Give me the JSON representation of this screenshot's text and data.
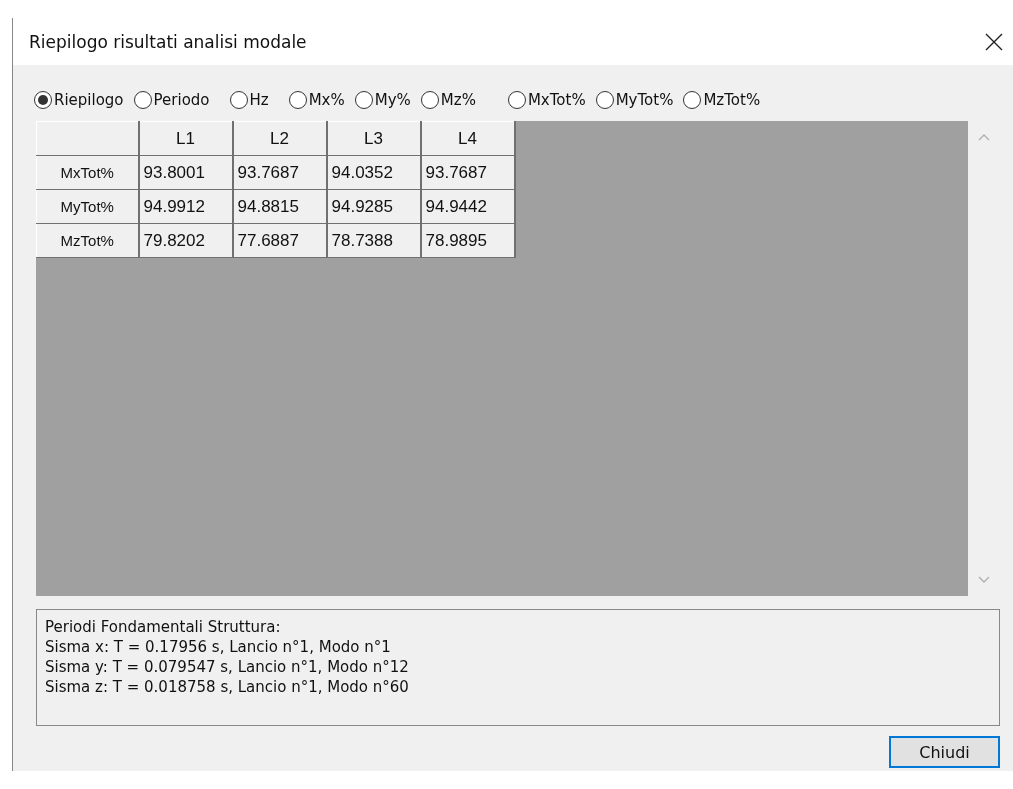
{
  "window": {
    "title": "Riepilogo risultati analisi modale"
  },
  "options": [
    {
      "label": "Riepilogo",
      "selected": true
    },
    {
      "label": "Periodo",
      "selected": false
    },
    {
      "label": "Hz",
      "selected": false
    },
    {
      "label": "Mx%",
      "selected": false
    },
    {
      "label": "My%",
      "selected": false
    },
    {
      "label": "Mz%",
      "selected": false
    },
    {
      "label": "MxTot%",
      "selected": false
    },
    {
      "label": "MyTot%",
      "selected": false
    },
    {
      "label": "MzTot%",
      "selected": false
    }
  ],
  "table": {
    "columns": [
      "L1",
      "L2",
      "L3",
      "L4"
    ],
    "rows": [
      {
        "header": "MxTot%",
        "cells": [
          "93.8001",
          "93.7687",
          "94.0352",
          "93.7687"
        ]
      },
      {
        "header": "MyTot%",
        "cells": [
          "94.9912",
          "94.8815",
          "94.9285",
          "94.9442"
        ]
      },
      {
        "header": "MzTot%",
        "cells": [
          "79.8202",
          "77.6887",
          "78.7388",
          "78.9895"
        ]
      }
    ]
  },
  "summary": [
    "Periodi Fondamentali Struttura:",
    "Sisma x: T = 0.17956 s, Lancio n°1, Modo n°1",
    "Sisma y: T = 0.079547 s, Lancio n°1, Modo n°12",
    "Sisma z: T = 0.018758 s, Lancio n°1, Modo n°60"
  ],
  "buttons": [
    "Chiudi"
  ]
}
